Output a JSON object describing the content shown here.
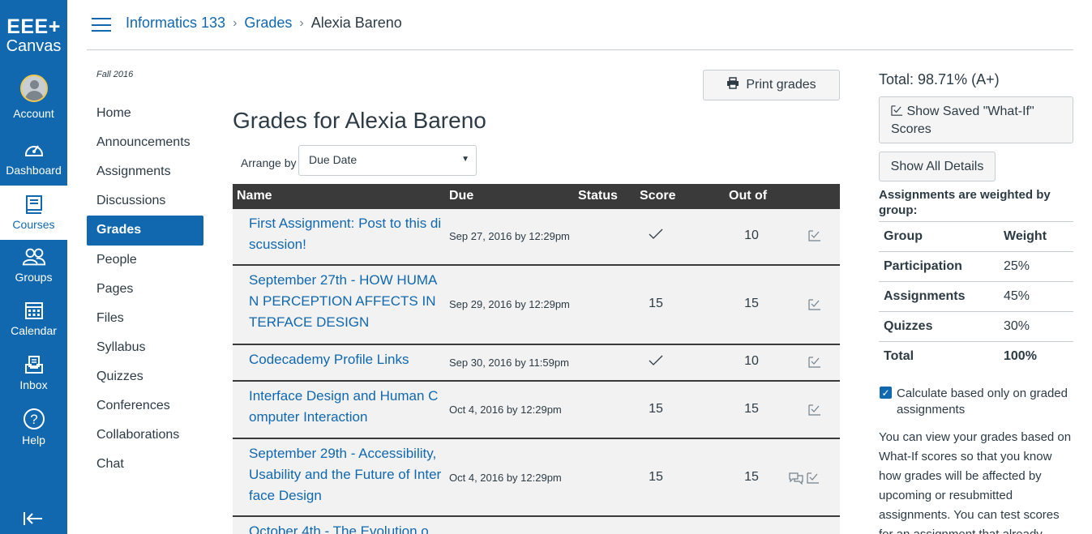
{
  "brand": {
    "line1": "EEE+",
    "line2": "Canvas"
  },
  "global_nav": [
    {
      "label": "Account",
      "icon": "account-avatar"
    },
    {
      "label": "Dashboard",
      "icon": "dashboard-icon"
    },
    {
      "label": "Courses",
      "icon": "courses-icon"
    },
    {
      "label": "Groups",
      "icon": "groups-icon"
    },
    {
      "label": "Calendar",
      "icon": "calendar-icon"
    },
    {
      "label": "Inbox",
      "icon": "inbox-icon"
    },
    {
      "label": "Help",
      "icon": "help-icon"
    }
  ],
  "breadcrumb": {
    "course": "Informatics 133",
    "section": "Grades",
    "current": "Alexia Bareno"
  },
  "course_nav": {
    "term": "Fall 2016",
    "items": [
      "Home",
      "Announcements",
      "Assignments",
      "Discussions",
      "Grades",
      "People",
      "Pages",
      "Files",
      "Syllabus",
      "Quizzes",
      "Conferences",
      "Collaborations",
      "Chat"
    ],
    "active": "Grades"
  },
  "main": {
    "print_label": "Print grades",
    "title": "Grades for Alexia Bareno",
    "arrange_label": "Arrange by",
    "arrange_value": "Due Date",
    "columns": {
      "name": "Name",
      "due": "Due",
      "status": "Status",
      "score": "Score",
      "out_of": "Out of"
    },
    "rows": [
      {
        "name": "First Assignment: Post to this discussion!",
        "due": "Sep 27, 2016 by 12:29pm",
        "score": "✓",
        "out_of": "10"
      },
      {
        "name": "September 27th - HOW HUMAN PERCEPTION AFFECTS INTERFACE DESIGN",
        "due": "Sep 29, 2016 by 12:29pm",
        "score": "15",
        "out_of": "15"
      },
      {
        "name": "Codecademy Profile Links",
        "due": "Sep 30, 2016 by 11:59pm",
        "score": "✓",
        "out_of": "10"
      },
      {
        "name": "Interface Design and Human Computer Interaction",
        "due": "Oct 4, 2016 by 12:29pm",
        "score": "15",
        "out_of": "15"
      },
      {
        "name": "September 29th - Accessibility, Usability and the Future of Interface Design",
        "due": "Oct 4, 2016 by 12:29pm",
        "score": "15",
        "out_of": "15"
      },
      {
        "name": "October 4th - The Evolution o",
        "due": "",
        "score": "",
        "out_of": ""
      }
    ]
  },
  "sidebar": {
    "total": "Total: 98.71% (A+)",
    "whatif_label": "Show Saved \"What-If\" Scores",
    "details_label": "Show All Details",
    "weighted_note": "Assignments are weighted by group:",
    "weights_header": {
      "group": "Group",
      "weight": "Weight"
    },
    "weights": [
      {
        "group": "Participation",
        "weight": "25%"
      },
      {
        "group": "Assignments",
        "weight": "45%"
      },
      {
        "group": "Quizzes",
        "weight": "30%"
      }
    ],
    "weights_total": {
      "group": "Total",
      "weight": "100%"
    },
    "calc_checked": true,
    "calc_label": "Calculate based only on graded assignments",
    "paragraph": "You can view your grades based on What-If scores so that you know how grades will be affected by upcoming or resubmitted assignments. You can test scores for an assignment that already"
  },
  "colors": {
    "brand": "#1168ae",
    "table_header": "#3a3a3a",
    "row_bg": "#f2f2f2"
  }
}
